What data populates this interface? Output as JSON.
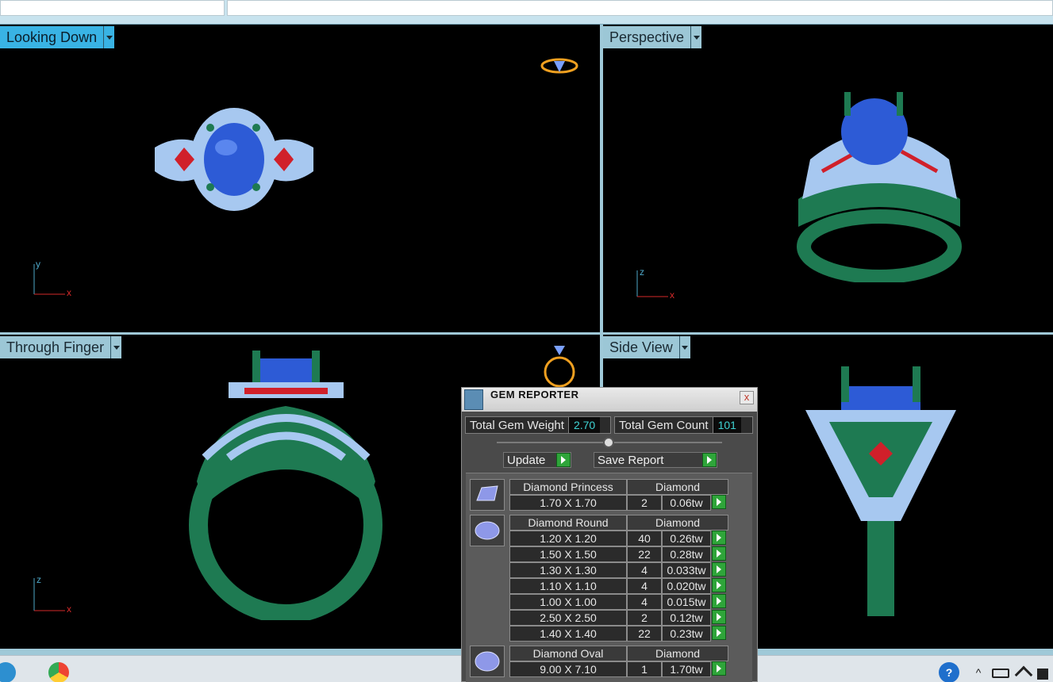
{
  "viewports": {
    "top_left": {
      "label": "Looking Down",
      "axis_x": "x",
      "axis_y": "y"
    },
    "top_right": {
      "label": "Perspective",
      "axis_x": "x",
      "axis_y": "z"
    },
    "bottom_left": {
      "label": "Through Finger",
      "axis_x": "x",
      "axis_y": "z"
    },
    "bottom_right": {
      "label": "Side View"
    }
  },
  "gem_reporter": {
    "title": "GEM REPORTER",
    "close": "x",
    "total_weight_label": "Total Gem Weight",
    "total_weight_value": "2.70",
    "total_count_label": "Total Gem Count",
    "total_count_value": "101",
    "update_label": "Update",
    "save_label": "Save Report",
    "groups": [
      {
        "shape": "Diamond Princess",
        "material": "Diamond",
        "rows": [
          {
            "size": "1.70 X 1.70",
            "count": "2",
            "weight": "0.06tw"
          }
        ]
      },
      {
        "shape": "Diamond Round",
        "material": "Diamond",
        "rows": [
          {
            "size": "1.20 X 1.20",
            "count": "40",
            "weight": "0.26tw"
          },
          {
            "size": "1.50 X 1.50",
            "count": "22",
            "weight": "0.28tw"
          },
          {
            "size": "1.30 X 1.30",
            "count": "4",
            "weight": "0.033tw"
          },
          {
            "size": "1.10 X 1.10",
            "count": "4",
            "weight": "0.020tw"
          },
          {
            "size": "1.00 X 1.00",
            "count": "4",
            "weight": "0.015tw"
          },
          {
            "size": "2.50 X 2.50",
            "count": "2",
            "weight": "0.12tw"
          },
          {
            "size": "1.40 X 1.40",
            "count": "22",
            "weight": "0.23tw"
          }
        ]
      },
      {
        "shape": "Diamond Oval",
        "material": "Diamond",
        "rows": [
          {
            "size": "9.00 X 7.10",
            "count": "1",
            "weight": "1.70tw"
          }
        ]
      }
    ]
  },
  "taskbar": {
    "icons": [
      "app-icon",
      "chrome-icon",
      "help-icon",
      "chevron-up-icon",
      "battery-icon",
      "wifi-icon",
      "volume-icon"
    ]
  },
  "colors": {
    "metal": "#1e7a52",
    "center_stone": "#2d5bd6",
    "accent_stone": "#d0202a",
    "pave": "#a7c8f0",
    "accent_label": "#39b3e4"
  }
}
